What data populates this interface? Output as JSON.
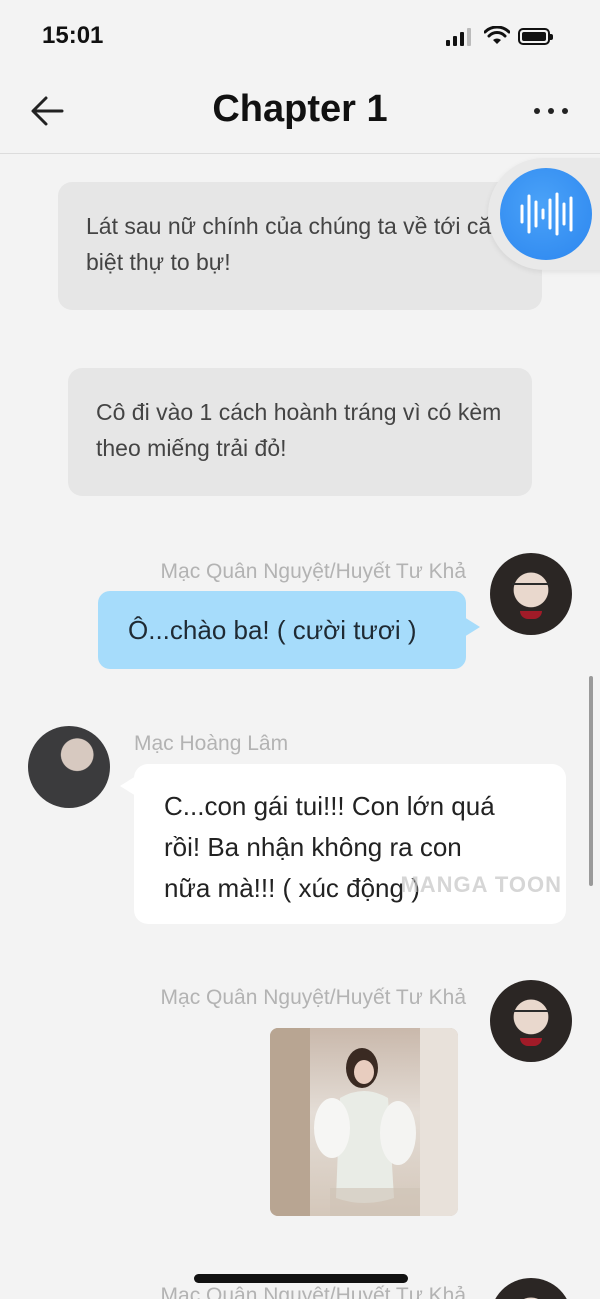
{
  "status_bar": {
    "time": "15:01"
  },
  "header": {
    "title": "Chapter 1"
  },
  "narrations": [
    "Lát sau nữ chính của chúng ta về tới căn biệt thự to bự!",
    "Cô đi vào 1 cách hoành tráng vì có kèm theo miếng trải đỏ!"
  ],
  "messages": [
    {
      "speaker": "Mạc Quân Nguyệt/Huyết Tư Khả",
      "text": "Ô...chào ba! ( cười tươi )"
    },
    {
      "speaker": "Mạc Hoàng Lâm",
      "text_lines": [
        "C...con gái tui!!! Con lớn quá",
        "rồi! Ba nhận không ra con",
        "nữa mà!!! ( xúc động )"
      ]
    },
    {
      "speaker": "Mạc Quân Nguyệt/Huyết Tư Khả"
    }
  ],
  "next_speaker_partial": "Mạc Quân Nguyệt/Huyết Tư Khả",
  "watermark": "MANGA TOON",
  "icons": {
    "back": "arrow-left-icon",
    "more": "more-horizontal-icon",
    "audio": "audio-waveform-icon"
  },
  "colors": {
    "accent_blue": "#2c86ef",
    "bubble_self": "#a6dcfb",
    "bubble_other": "#ffffff",
    "narration_bg": "#e6e6e6"
  }
}
